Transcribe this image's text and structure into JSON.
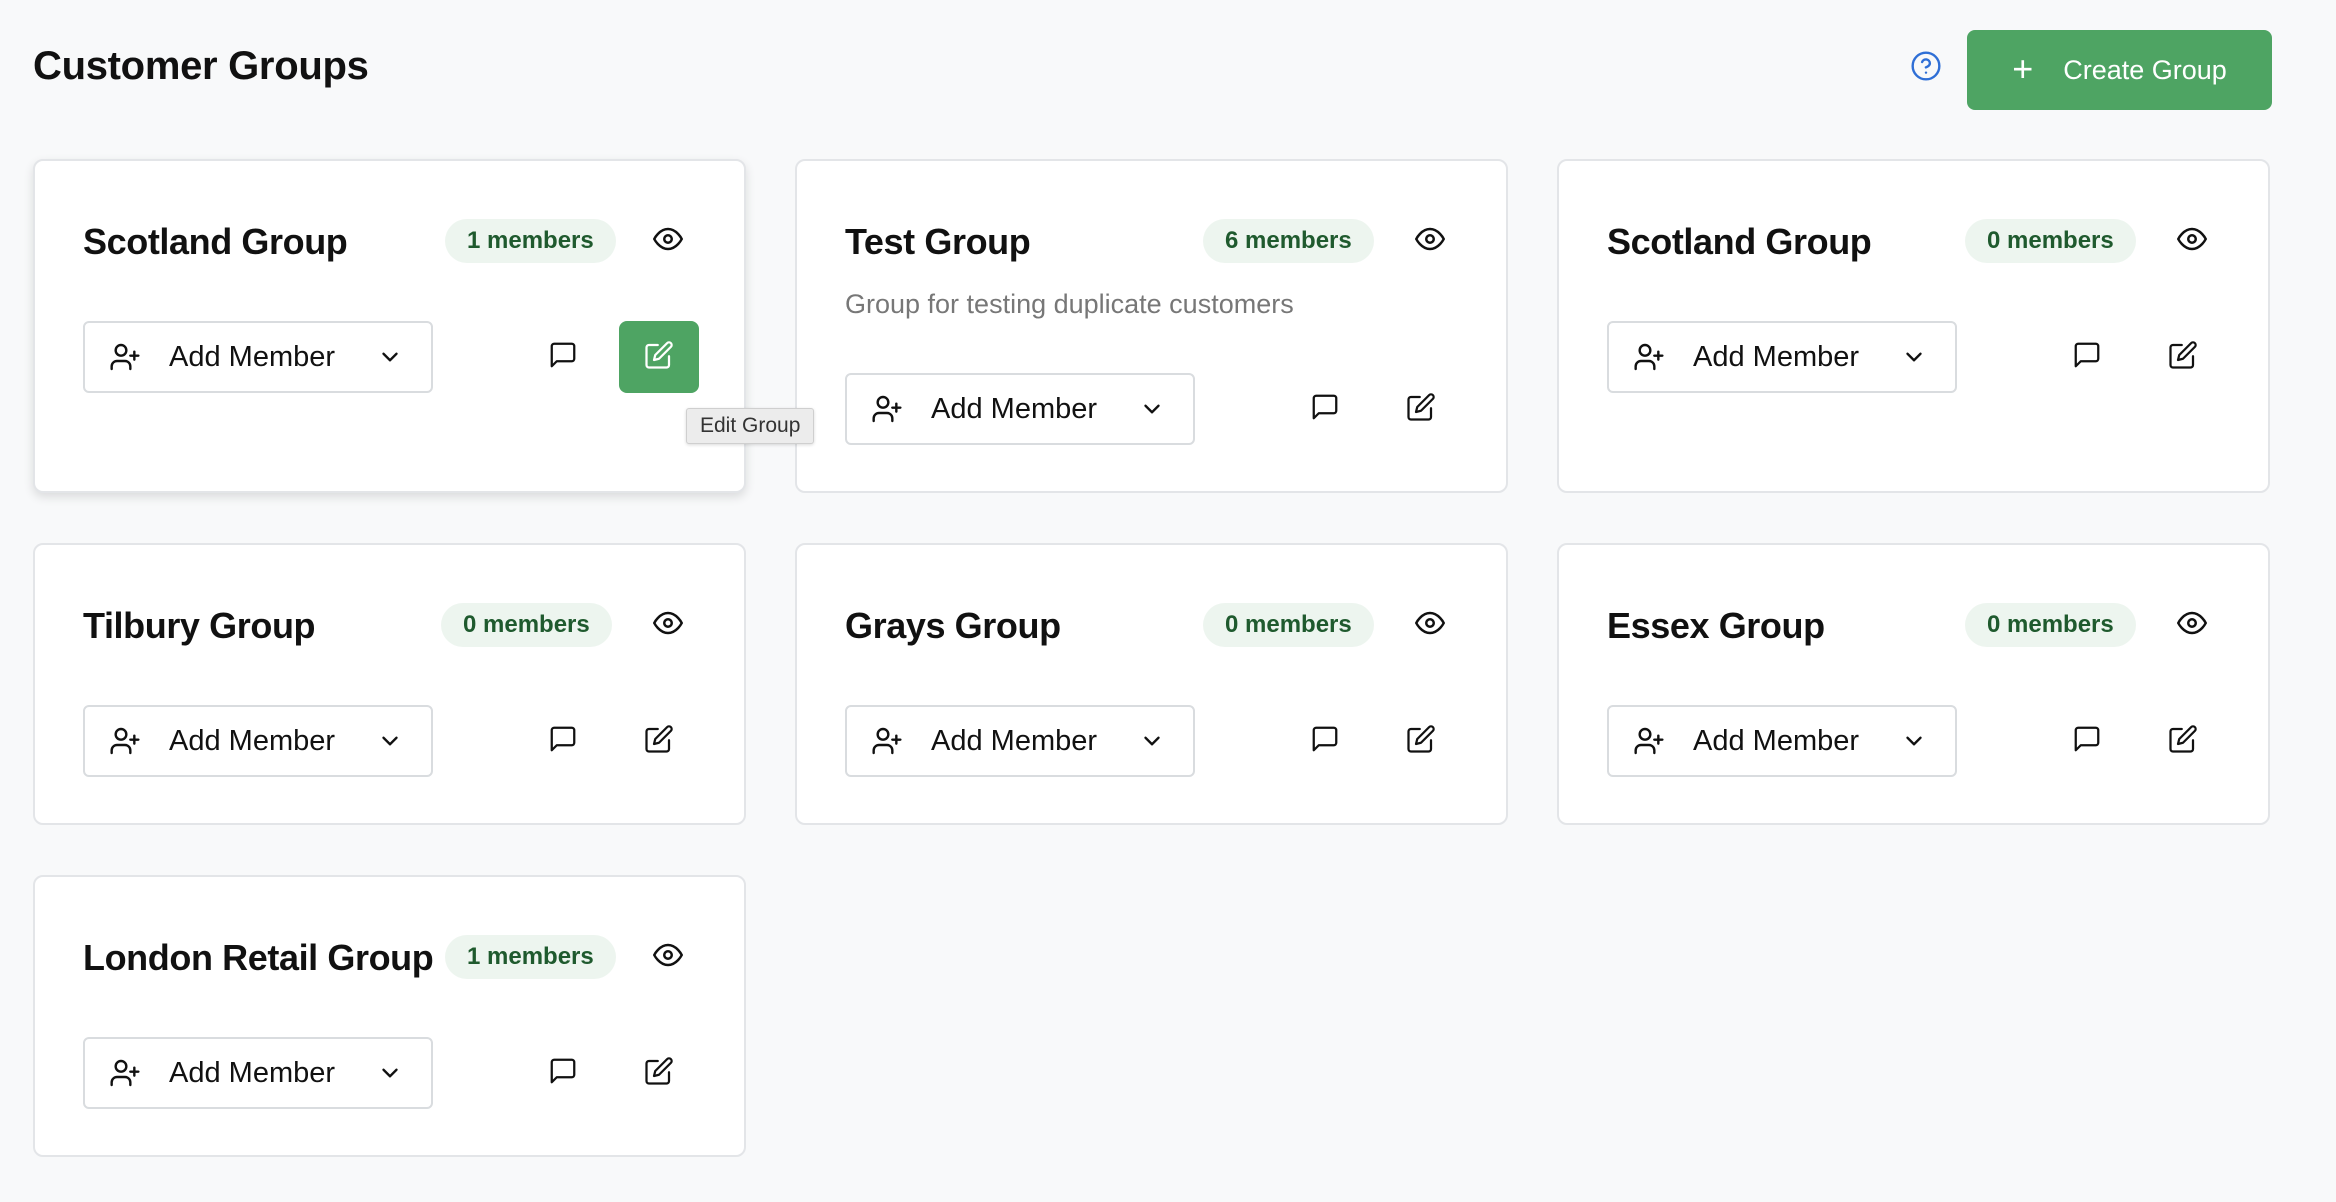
{
  "header": {
    "title": "Customer Groups",
    "create_button_label": "Create Group",
    "help_icon": "question-circle-icon"
  },
  "colors": {
    "primary": "#4ea463",
    "badge_bg": "#edf5ef",
    "badge_text": "#1f5a2e",
    "help_icon": "#2f6fd6"
  },
  "cards": [
    {
      "title": "Scotland Group",
      "members": "1 members",
      "description": "",
      "add_member_label": "Add Member",
      "edit_active": true
    },
    {
      "title": "Test Group",
      "members": "6 members",
      "description": "Group for testing duplicate customers",
      "add_member_label": "Add Member",
      "edit_active": false
    },
    {
      "title": "Scotland Group",
      "members": "0 members",
      "description": "",
      "add_member_label": "Add Member",
      "edit_active": false
    },
    {
      "title": "Tilbury Group",
      "members": "0 members",
      "description": "",
      "add_member_label": "Add Member",
      "edit_active": false
    },
    {
      "title": "Grays Group",
      "members": "0 members",
      "description": "",
      "add_member_label": "Add Member",
      "edit_active": false
    },
    {
      "title": "Essex Group",
      "members": "0 members",
      "description": "",
      "add_member_label": "Add Member",
      "edit_active": false
    },
    {
      "title": "London Retail Group",
      "members": "1 members",
      "description": "",
      "add_member_label": "Add Member",
      "edit_active": false
    }
  ],
  "tooltip": {
    "text": "Edit Group"
  }
}
